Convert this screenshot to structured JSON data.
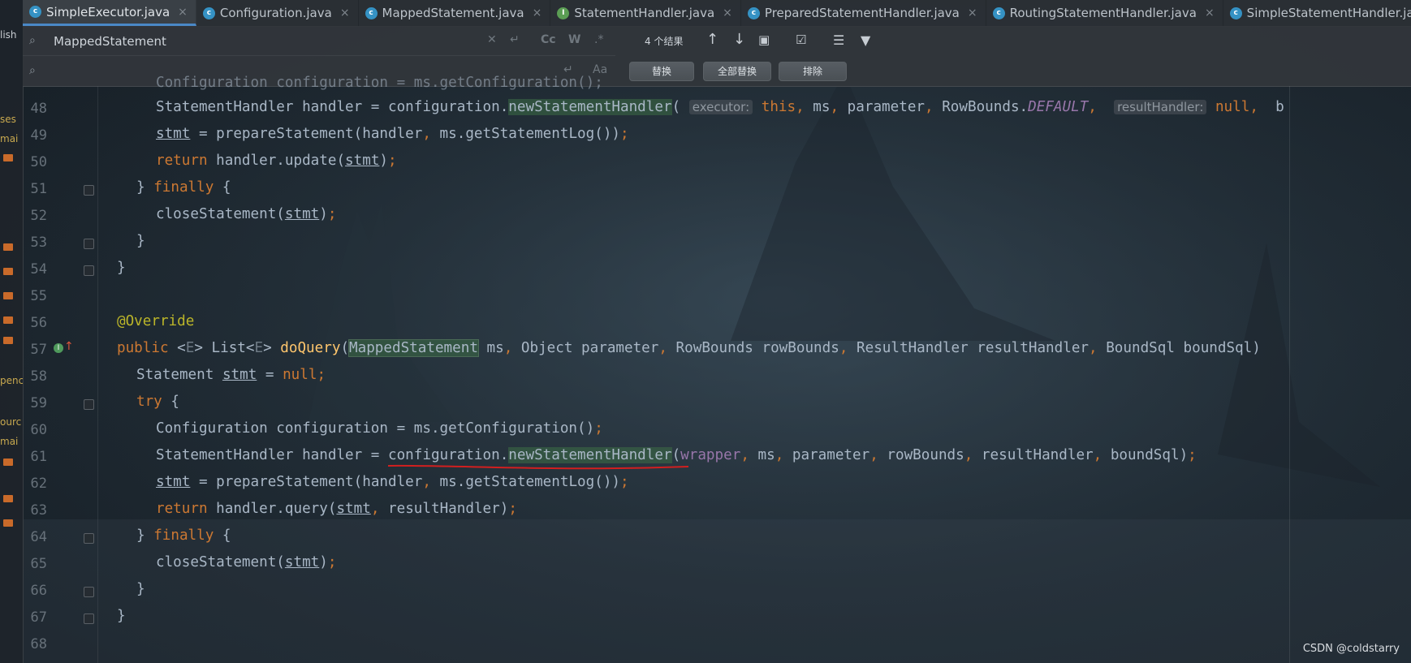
{
  "tabs": [
    {
      "label": "SimpleExecutor.java",
      "icon": "class-icon",
      "active": true
    },
    {
      "label": "Configuration.java",
      "icon": "class-icon"
    },
    {
      "label": "MappedStatement.java",
      "icon": "class-icon"
    },
    {
      "label": "StatementHandler.java",
      "icon": "interface-icon"
    },
    {
      "label": "PreparedStatementHandler.java",
      "icon": "class-icon"
    },
    {
      "label": "RoutingStatementHandler.java",
      "icon": "class-icon"
    },
    {
      "label": "SimpleStatementHandler.java",
      "icon": "class-icon"
    }
  ],
  "find": {
    "query": "MappedStatement",
    "replace": "",
    "results": "4 个结果",
    "options": {
      "match_case": "Cc",
      "words": "W",
      "regex": ".*"
    },
    "buttons": {
      "replace": "替换",
      "replace_all": "全部替换",
      "exclude": "排除"
    }
  },
  "left_strip": [
    "lish",
    "ses",
    "mai",
    "penc",
    "ourc",
    "mai"
  ],
  "editor": {
    "lines": [
      "48",
      "49",
      "50",
      "51",
      "52",
      "53",
      "54",
      "55",
      "56",
      "57",
      "58",
      "59",
      "60",
      "61",
      "62",
      "63",
      "64",
      "65",
      "66",
      "67",
      "68"
    ],
    "hint_executor": "executor:",
    "hint_result_handler": "resultHandler:",
    "partial_top": "Configuration configuration = ms.getConfiguration();"
  },
  "watermark": "CSDN @coldstarry",
  "colors": {
    "keyword": "#cc7832",
    "method": "#ffc66d",
    "annotation": "#bbb529",
    "field": "#9876aa",
    "text": "#a9b7c6",
    "red_underline": "#d21f1f"
  }
}
